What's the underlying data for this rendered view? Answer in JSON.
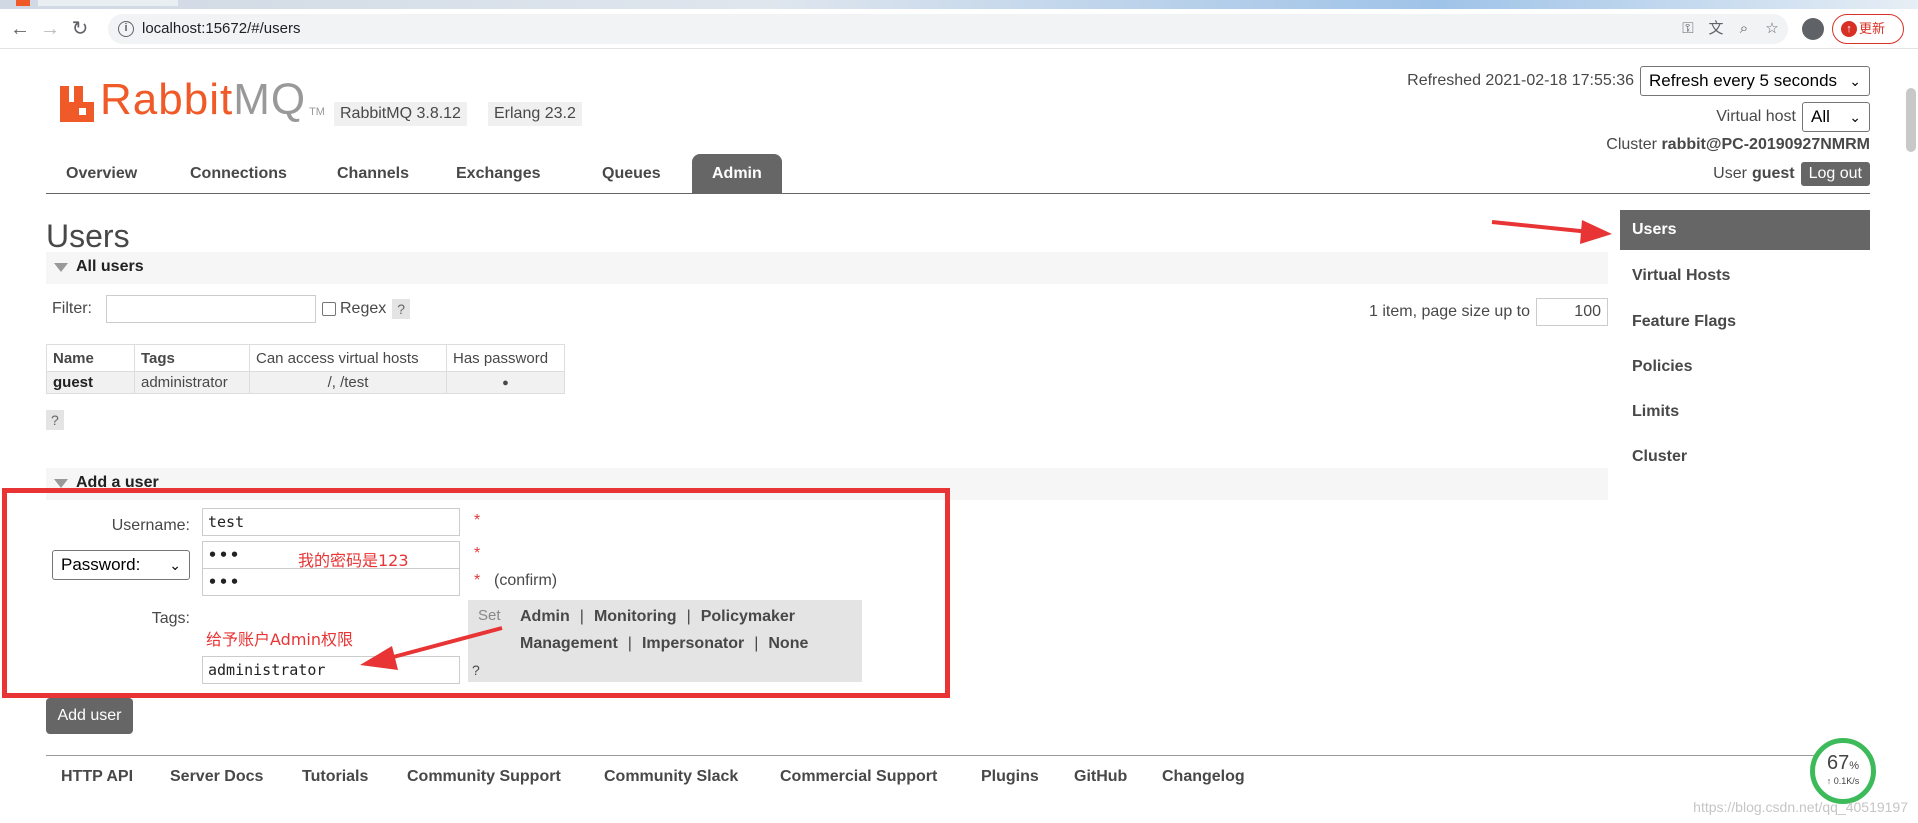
{
  "browser": {
    "url": "localhost:15672/#/users",
    "update_label": "更新"
  },
  "header": {
    "logo_rabbit": "Rabbit",
    "logo_mq": "MQ",
    "logo_tm": "TM",
    "version_rabbit": "RabbitMQ 3.8.12",
    "version_erlang": "Erlang 23.2",
    "refreshed_text": "Refreshed 2021-02-18 17:55:36",
    "refresh_select": "Refresh every 5 seconds",
    "vhost_label": "Virtual host",
    "vhost_select": "All",
    "cluster_label": "Cluster",
    "cluster_name": "rabbit@PC-20190927NMRM",
    "user_label": "User",
    "user_name": "guest",
    "logout_label": "Log out"
  },
  "tabs": [
    "Overview",
    "Connections",
    "Channels",
    "Exchanges",
    "Queues",
    "Admin"
  ],
  "page": {
    "title": "Users",
    "all_users_label": "All users",
    "filter_label": "Filter:",
    "regex_label": "Regex",
    "help_q": "?",
    "paging_text": "1 item, page size up to",
    "page_size": "100"
  },
  "users_table": {
    "headers": [
      "Name",
      "Tags",
      "Can access virtual hosts",
      "Has password"
    ],
    "rows": [
      [
        "guest",
        "administrator",
        "/, /test",
        "●"
      ]
    ]
  },
  "add_user": {
    "section_label": "Add a user",
    "username_label": "Username:",
    "username_value": "test",
    "password_select": "Password:",
    "password_value": "•••",
    "confirm_value": "•••",
    "confirm_label": "(confirm)",
    "required_mark": "*",
    "tags_label": "Tags:",
    "tags_value": "administrator",
    "set_label": "Set",
    "tag_options": [
      "Admin",
      "Monitoring",
      "Policymaker",
      "Management",
      "Impersonator",
      "None"
    ],
    "tags_help": "?",
    "add_button": "Add user"
  },
  "annotations": {
    "password_note": "我的密码是123",
    "tags_note": "给予账户Admin权限"
  },
  "sidebar": {
    "items": [
      "Users",
      "Virtual Hosts",
      "Feature Flags",
      "Policies",
      "Limits",
      "Cluster"
    ]
  },
  "footer": {
    "links": [
      "HTTP API",
      "Server Docs",
      "Tutorials",
      "Community Support",
      "Community Slack",
      "Commercial Support",
      "Plugins",
      "GitHub",
      "Changelog"
    ]
  },
  "overlay": {
    "speed_pct": "67",
    "speed_unit": "%",
    "speed_rate": "↑ 0.1K/s",
    "watermark": "https://blog.csdn.net/qq_40519197"
  },
  "colors": {
    "brand": "#f05a28",
    "tab_active": "#666666",
    "annotation": "#e83434",
    "speed_ring": "#3dbb5b"
  }
}
